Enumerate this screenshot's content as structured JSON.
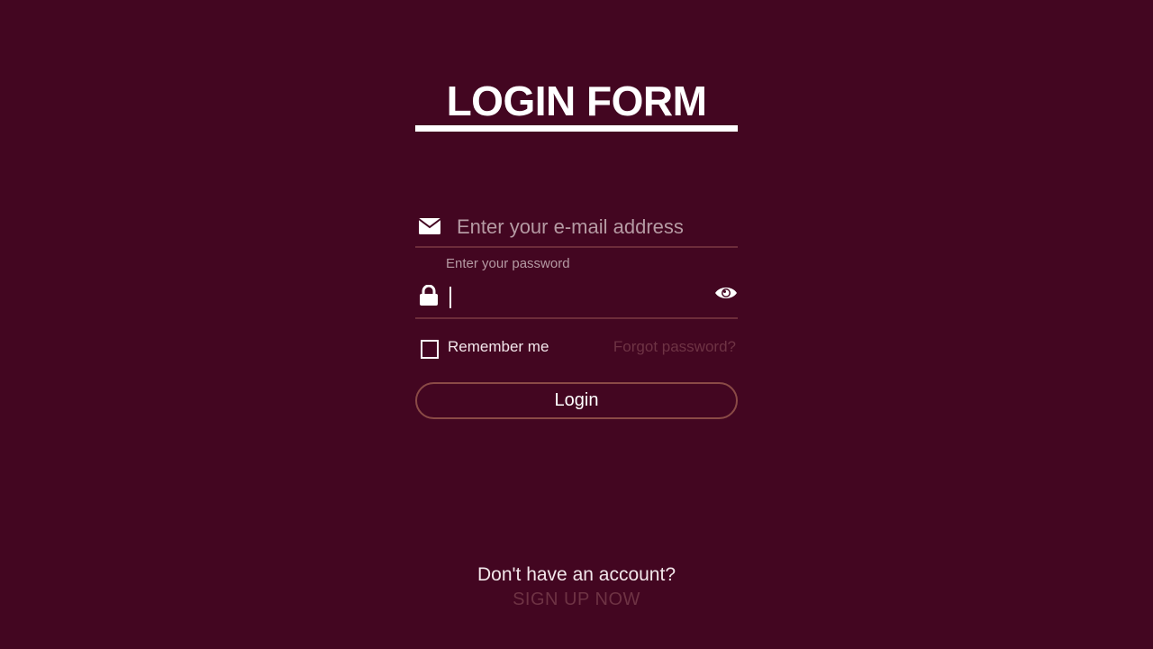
{
  "page": {
    "background_color": "#430621",
    "title": "LOGIN FORM"
  },
  "email": {
    "icon": "envelope-icon",
    "placeholder": "Enter your e-mail address",
    "value": ""
  },
  "password": {
    "icon": "lock-icon",
    "label": "Enter your password",
    "value": "",
    "toggle_icon": "eye-icon"
  },
  "options": {
    "remember_label": "Remember me",
    "remember_checked": false,
    "forgot_label": "Forgot password?"
  },
  "actions": {
    "login_label": "Login"
  },
  "footer": {
    "question": "Don't have an account?",
    "signup_label": "SIGN UP NOW"
  },
  "colors": {
    "accent": "#6e3344",
    "button_border": "#8a4a46",
    "field_underline": "#6d2c3a"
  }
}
